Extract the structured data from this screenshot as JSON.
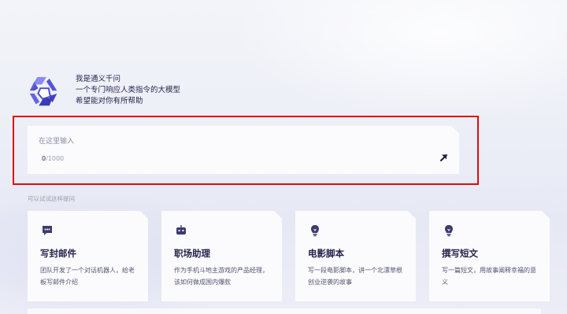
{
  "intro": {
    "line1": "我是通义千问",
    "line2": "一个专门响应人类指令的大模型",
    "line3": "希望能对你有所帮助"
  },
  "input": {
    "placeholder": "在这里输入",
    "count": "0",
    "max": "/1000"
  },
  "suggestions": {
    "label": "可以试试这样提问",
    "cards": [
      {
        "title": "写封邮件",
        "desc": "团队开发了一个对话机器人，给老板写邮件介绍",
        "icon": "chat-bubble-icon"
      },
      {
        "title": "职场助理",
        "desc": "作为手机斗地主游戏的产品经理，该如何做成国内爆款",
        "icon": "robot-icon"
      },
      {
        "title": "电影脚本",
        "desc": "写一段电影脚本，讲一个北漂草根创业逆袭的故事",
        "icon": "bulb-icon"
      },
      {
        "title": "撰写短文",
        "desc": "写一篇短文，用故事阐释幸福的意义",
        "icon": "bulb-icon"
      }
    ]
  },
  "colors": {
    "accent": "#3c3a6e",
    "highlight_border": "#e00b0b",
    "text_primary": "#26244c"
  }
}
